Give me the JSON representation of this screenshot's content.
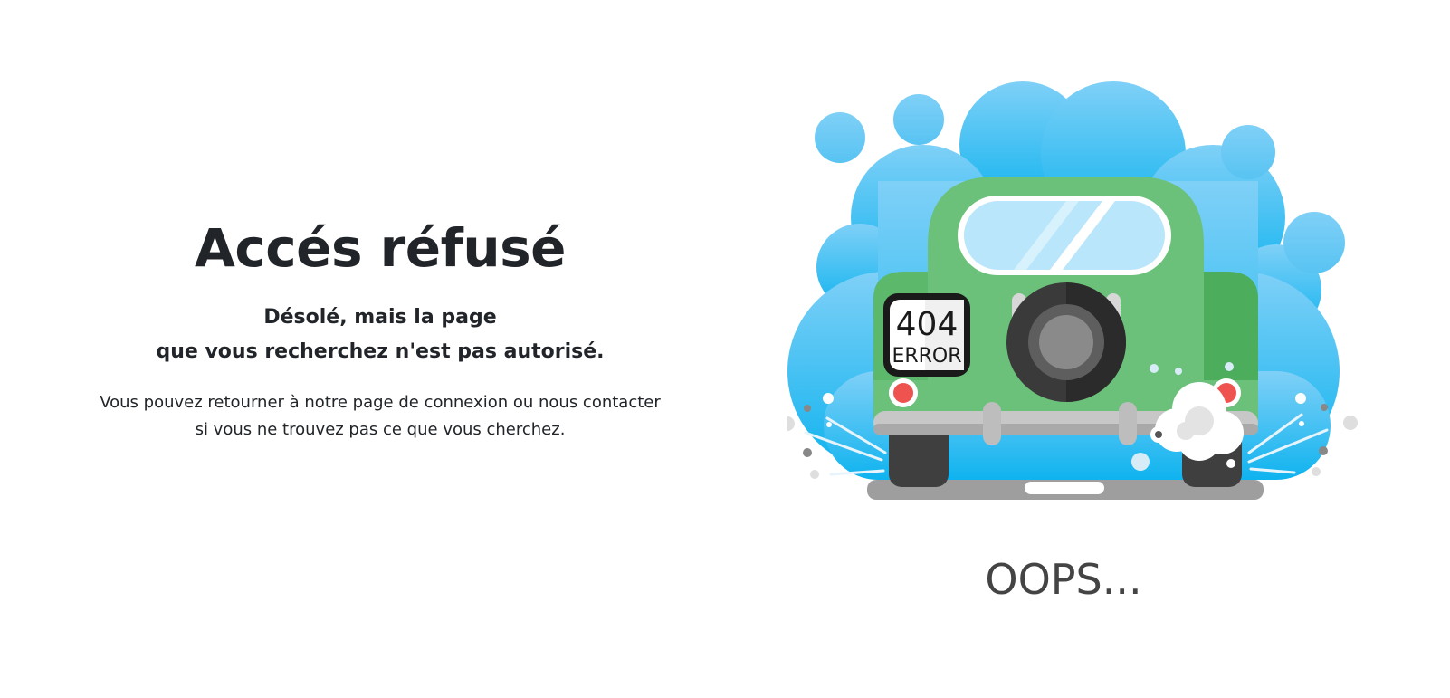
{
  "heading": {
    "title": "Accés réfusé",
    "subtitle_line1": "Désolé, mais la page",
    "subtitle_line2": "que vous recherchez n'est pas autorisé."
  },
  "message": {
    "line1": "Vous pouvez retourner à notre page de connexion ou nous contacter",
    "line2": "si vous ne trouvez pas ce que vous cherchez."
  },
  "illustration": {
    "plate_number": "404",
    "plate_text": "ERROR",
    "caption": "OOPS...",
    "colors": {
      "cloud_light": "#7fd0f7",
      "cloud_dark": "#0fb3ef",
      "car_body": "#5dbb6a",
      "tire": "#3a3a3a",
      "bumper": "#b8b8b8",
      "light": "#ef5350"
    }
  }
}
